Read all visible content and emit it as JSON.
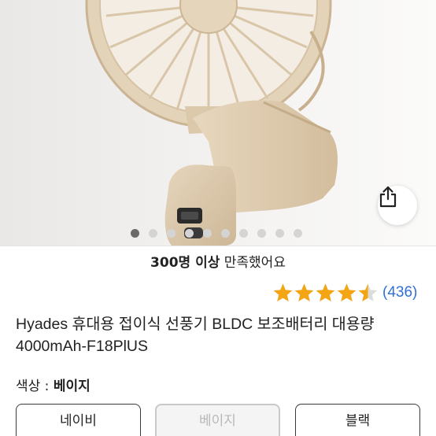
{
  "gallery": {
    "image_alt": "Hyades portable folding fan, beige",
    "dot_count": 10,
    "active_index": 0,
    "share_icon": "share-icon"
  },
  "satisfaction": {
    "strong": "300명 이상",
    "rest": " 만족했어요"
  },
  "rating": {
    "stars": 4.5,
    "star_color": "#f3a514",
    "review_count": "(436)"
  },
  "product": {
    "title": "Hyades 휴대용 접이식 선풍기 BLDC 보조배터리 대용량4000mAh-F18PlUS"
  },
  "color_option": {
    "label": "색상 : ",
    "value": "베이지"
  },
  "options": [
    {
      "label": "네이비",
      "selected": false
    },
    {
      "label": "베이지",
      "selected": true
    },
    {
      "label": "블랙",
      "selected": false
    }
  ]
}
